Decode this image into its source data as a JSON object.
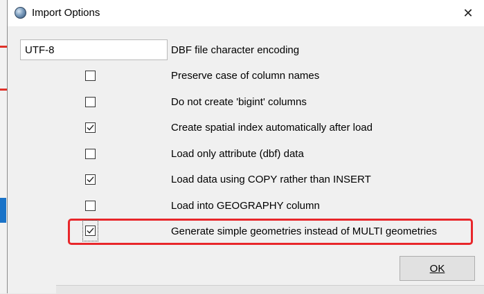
{
  "window": {
    "title": "Import Options"
  },
  "encoding": {
    "value": "UTF-8",
    "label": "DBF file character encoding"
  },
  "options": [
    {
      "label": "Preserve case of column names",
      "checked": false
    },
    {
      "label": "Do not create 'bigint' columns",
      "checked": false
    },
    {
      "label": "Create spatial index automatically after load",
      "checked": true
    },
    {
      "label": "Load only attribute (dbf) data",
      "checked": false
    },
    {
      "label": "Load data using COPY rather than INSERT",
      "checked": true
    },
    {
      "label": "Load into GEOGRAPHY column",
      "checked": false
    },
    {
      "label": "Generate simple geometries instead of MULTI geometries",
      "checked": true
    }
  ],
  "buttons": {
    "ok": "OK",
    "close": "✕"
  },
  "colors": {
    "highlight": "#e8262a",
    "dialog_bg": "#f0f0f0"
  }
}
